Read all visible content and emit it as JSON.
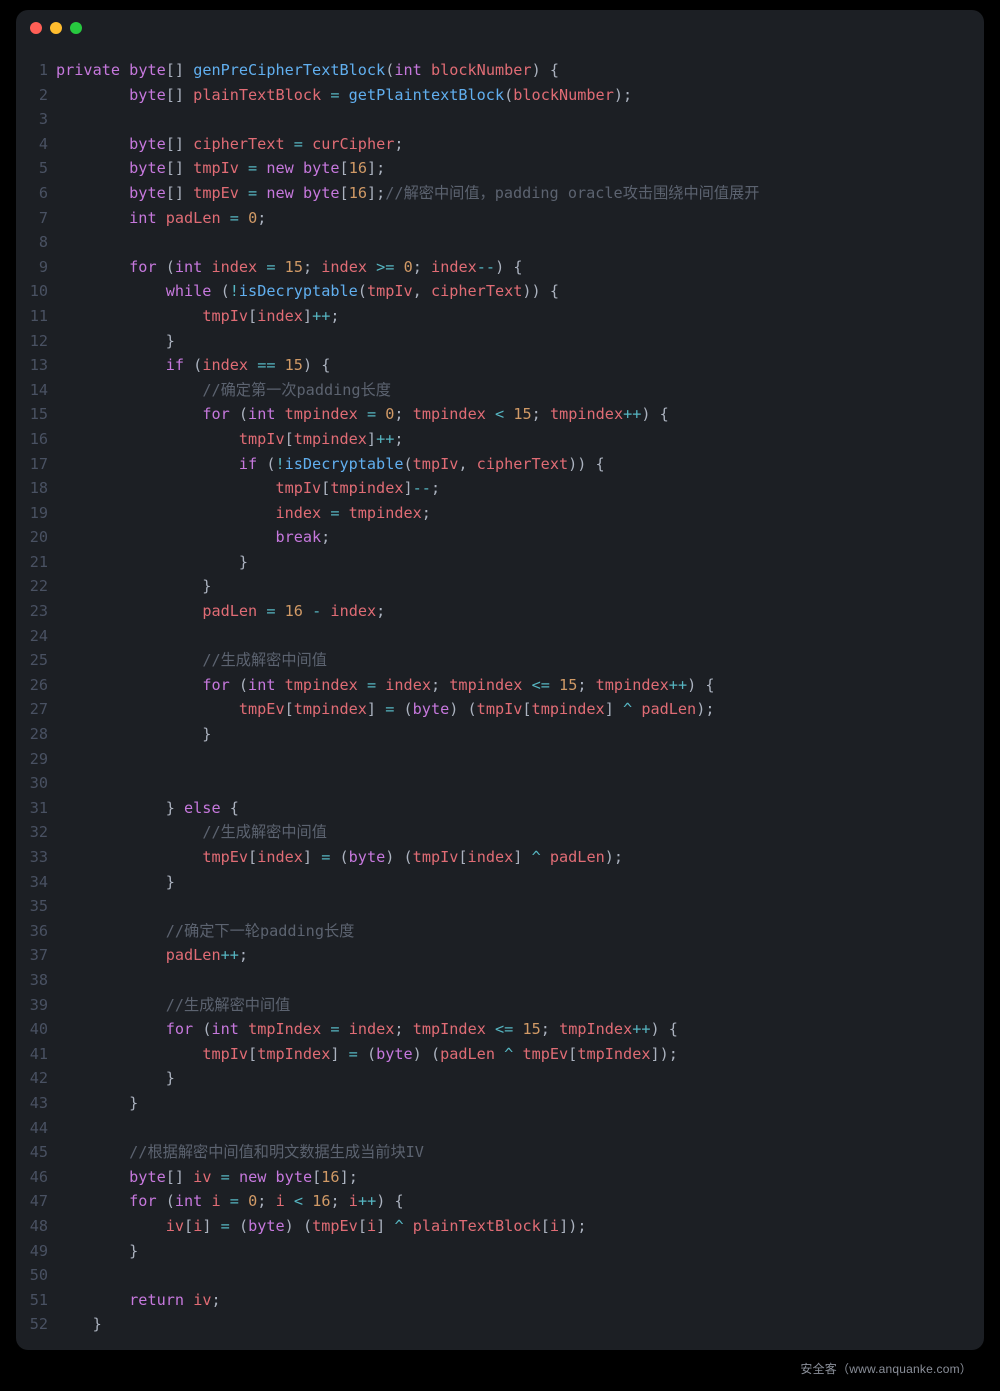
{
  "watermark": "安全客（www.anquanke.com）",
  "code": [
    [
      [
        "kw",
        "private"
      ],
      [
        "pun",
        " "
      ],
      [
        "type",
        "byte"
      ],
      [
        "pun",
        "[] "
      ],
      [
        "fn",
        "genPreCipherTextBlock"
      ],
      [
        "pun",
        "("
      ],
      [
        "type",
        "int"
      ],
      [
        "pun",
        " "
      ],
      [
        "id",
        "blockNumber"
      ],
      [
        "pun",
        ") {"
      ]
    ],
    [
      [
        "pun",
        "        "
      ],
      [
        "type",
        "byte"
      ],
      [
        "pun",
        "[] "
      ],
      [
        "id",
        "plainTextBlock"
      ],
      [
        "pun",
        " "
      ],
      [
        "op",
        "="
      ],
      [
        "pun",
        " "
      ],
      [
        "fn",
        "getPlaintextBlock"
      ],
      [
        "pun",
        "("
      ],
      [
        "id",
        "blockNumber"
      ],
      [
        "pun",
        ");"
      ]
    ],
    [],
    [
      [
        "pun",
        "        "
      ],
      [
        "type",
        "byte"
      ],
      [
        "pun",
        "[] "
      ],
      [
        "id",
        "cipherText"
      ],
      [
        "pun",
        " "
      ],
      [
        "op",
        "="
      ],
      [
        "pun",
        " "
      ],
      [
        "id",
        "curCipher"
      ],
      [
        "pun",
        ";"
      ]
    ],
    [
      [
        "pun",
        "        "
      ],
      [
        "type",
        "byte"
      ],
      [
        "pun",
        "[] "
      ],
      [
        "id",
        "tmpIv"
      ],
      [
        "pun",
        " "
      ],
      [
        "op",
        "="
      ],
      [
        "pun",
        " "
      ],
      [
        "kw",
        "new"
      ],
      [
        "pun",
        " "
      ],
      [
        "type",
        "byte"
      ],
      [
        "pun",
        "["
      ],
      [
        "num",
        "16"
      ],
      [
        "pun",
        "];"
      ]
    ],
    [
      [
        "pun",
        "        "
      ],
      [
        "type",
        "byte"
      ],
      [
        "pun",
        "[] "
      ],
      [
        "id",
        "tmpEv"
      ],
      [
        "pun",
        " "
      ],
      [
        "op",
        "="
      ],
      [
        "pun",
        " "
      ],
      [
        "kw",
        "new"
      ],
      [
        "pun",
        " "
      ],
      [
        "type",
        "byte"
      ],
      [
        "pun",
        "["
      ],
      [
        "num",
        "16"
      ],
      [
        "pun",
        "];"
      ],
      [
        "cmt",
        "//解密中间值，padding oracle攻击围绕中间值展开"
      ]
    ],
    [
      [
        "pun",
        "        "
      ],
      [
        "type",
        "int"
      ],
      [
        "pun",
        " "
      ],
      [
        "id",
        "padLen"
      ],
      [
        "pun",
        " "
      ],
      [
        "op",
        "="
      ],
      [
        "pun",
        " "
      ],
      [
        "num",
        "0"
      ],
      [
        "pun",
        ";"
      ]
    ],
    [],
    [
      [
        "pun",
        "        "
      ],
      [
        "kw",
        "for"
      ],
      [
        "pun",
        " ("
      ],
      [
        "type",
        "int"
      ],
      [
        "pun",
        " "
      ],
      [
        "id",
        "index"
      ],
      [
        "pun",
        " "
      ],
      [
        "op",
        "="
      ],
      [
        "pun",
        " "
      ],
      [
        "num",
        "15"
      ],
      [
        "pun",
        "; "
      ],
      [
        "id",
        "index"
      ],
      [
        "pun",
        " "
      ],
      [
        "op",
        ">="
      ],
      [
        "pun",
        " "
      ],
      [
        "num",
        "0"
      ],
      [
        "pun",
        "; "
      ],
      [
        "id",
        "index"
      ],
      [
        "op",
        "--"
      ],
      [
        "pun",
        ") {"
      ]
    ],
    [
      [
        "pun",
        "            "
      ],
      [
        "kw",
        "while"
      ],
      [
        "pun",
        " ("
      ],
      [
        "op",
        "!"
      ],
      [
        "fn",
        "isDecryptable"
      ],
      [
        "pun",
        "("
      ],
      [
        "id",
        "tmpIv"
      ],
      [
        "pun",
        ", "
      ],
      [
        "id",
        "cipherText"
      ],
      [
        "pun",
        ")) {"
      ]
    ],
    [
      [
        "pun",
        "                "
      ],
      [
        "id",
        "tmpIv"
      ],
      [
        "pun",
        "["
      ],
      [
        "id",
        "index"
      ],
      [
        "pun",
        "]"
      ],
      [
        "op",
        "++"
      ],
      [
        "pun",
        ";"
      ]
    ],
    [
      [
        "pun",
        "            }"
      ]
    ],
    [
      [
        "pun",
        "            "
      ],
      [
        "kw",
        "if"
      ],
      [
        "pun",
        " ("
      ],
      [
        "id",
        "index"
      ],
      [
        "pun",
        " "
      ],
      [
        "op",
        "=="
      ],
      [
        "pun",
        " "
      ],
      [
        "num",
        "15"
      ],
      [
        "pun",
        ") {"
      ]
    ],
    [
      [
        "pun",
        "                "
      ],
      [
        "cmt",
        "//确定第一次padding长度"
      ]
    ],
    [
      [
        "pun",
        "                "
      ],
      [
        "kw",
        "for"
      ],
      [
        "pun",
        " ("
      ],
      [
        "type",
        "int"
      ],
      [
        "pun",
        " "
      ],
      [
        "id",
        "tmpindex"
      ],
      [
        "pun",
        " "
      ],
      [
        "op",
        "="
      ],
      [
        "pun",
        " "
      ],
      [
        "num",
        "0"
      ],
      [
        "pun",
        "; "
      ],
      [
        "id",
        "tmpindex"
      ],
      [
        "pun",
        " "
      ],
      [
        "op",
        "<"
      ],
      [
        "pun",
        " "
      ],
      [
        "num",
        "15"
      ],
      [
        "pun",
        "; "
      ],
      [
        "id",
        "tmpindex"
      ],
      [
        "op",
        "++"
      ],
      [
        "pun",
        ") {"
      ]
    ],
    [
      [
        "pun",
        "                    "
      ],
      [
        "id",
        "tmpIv"
      ],
      [
        "pun",
        "["
      ],
      [
        "id",
        "tmpindex"
      ],
      [
        "pun",
        "]"
      ],
      [
        "op",
        "++"
      ],
      [
        "pun",
        ";"
      ]
    ],
    [
      [
        "pun",
        "                    "
      ],
      [
        "kw",
        "if"
      ],
      [
        "pun",
        " ("
      ],
      [
        "op",
        "!"
      ],
      [
        "fn",
        "isDecryptable"
      ],
      [
        "pun",
        "("
      ],
      [
        "id",
        "tmpIv"
      ],
      [
        "pun",
        ", "
      ],
      [
        "id",
        "cipherText"
      ],
      [
        "pun",
        ")) {"
      ]
    ],
    [
      [
        "pun",
        "                        "
      ],
      [
        "id",
        "tmpIv"
      ],
      [
        "pun",
        "["
      ],
      [
        "id",
        "tmpindex"
      ],
      [
        "pun",
        "]"
      ],
      [
        "op",
        "--"
      ],
      [
        "pun",
        ";"
      ]
    ],
    [
      [
        "pun",
        "                        "
      ],
      [
        "id",
        "index"
      ],
      [
        "pun",
        " "
      ],
      [
        "op",
        "="
      ],
      [
        "pun",
        " "
      ],
      [
        "id",
        "tmpindex"
      ],
      [
        "pun",
        ";"
      ]
    ],
    [
      [
        "pun",
        "                        "
      ],
      [
        "kw",
        "break"
      ],
      [
        "pun",
        ";"
      ]
    ],
    [
      [
        "pun",
        "                    }"
      ]
    ],
    [
      [
        "pun",
        "                }"
      ]
    ],
    [
      [
        "pun",
        "                "
      ],
      [
        "id",
        "padLen"
      ],
      [
        "pun",
        " "
      ],
      [
        "op",
        "="
      ],
      [
        "pun",
        " "
      ],
      [
        "num",
        "16"
      ],
      [
        "pun",
        " "
      ],
      [
        "op",
        "-"
      ],
      [
        "pun",
        " "
      ],
      [
        "id",
        "index"
      ],
      [
        "pun",
        ";"
      ]
    ],
    [],
    [
      [
        "pun",
        "                "
      ],
      [
        "cmt",
        "//生成解密中间值"
      ]
    ],
    [
      [
        "pun",
        "                "
      ],
      [
        "kw",
        "for"
      ],
      [
        "pun",
        " ("
      ],
      [
        "type",
        "int"
      ],
      [
        "pun",
        " "
      ],
      [
        "id",
        "tmpindex"
      ],
      [
        "pun",
        " "
      ],
      [
        "op",
        "="
      ],
      [
        "pun",
        " "
      ],
      [
        "id",
        "index"
      ],
      [
        "pun",
        "; "
      ],
      [
        "id",
        "tmpindex"
      ],
      [
        "pun",
        " "
      ],
      [
        "op",
        "<="
      ],
      [
        "pun",
        " "
      ],
      [
        "num",
        "15"
      ],
      [
        "pun",
        "; "
      ],
      [
        "id",
        "tmpindex"
      ],
      [
        "op",
        "++"
      ],
      [
        "pun",
        ") {"
      ]
    ],
    [
      [
        "pun",
        "                    "
      ],
      [
        "id",
        "tmpEv"
      ],
      [
        "pun",
        "["
      ],
      [
        "id",
        "tmpindex"
      ],
      [
        "pun",
        "] "
      ],
      [
        "op",
        "="
      ],
      [
        "pun",
        " ("
      ],
      [
        "type",
        "byte"
      ],
      [
        "pun",
        ") ("
      ],
      [
        "id",
        "tmpIv"
      ],
      [
        "pun",
        "["
      ],
      [
        "id",
        "tmpindex"
      ],
      [
        "pun",
        "] "
      ],
      [
        "op",
        "^"
      ],
      [
        "pun",
        " "
      ],
      [
        "id",
        "padLen"
      ],
      [
        "pun",
        ");"
      ]
    ],
    [
      [
        "pun",
        "                }"
      ]
    ],
    [],
    [],
    [
      [
        "pun",
        "            } "
      ],
      [
        "kw",
        "else"
      ],
      [
        "pun",
        " {"
      ]
    ],
    [
      [
        "pun",
        "                "
      ],
      [
        "cmt",
        "//生成解密中间值"
      ]
    ],
    [
      [
        "pun",
        "                "
      ],
      [
        "id",
        "tmpEv"
      ],
      [
        "pun",
        "["
      ],
      [
        "id",
        "index"
      ],
      [
        "pun",
        "] "
      ],
      [
        "op",
        "="
      ],
      [
        "pun",
        " ("
      ],
      [
        "type",
        "byte"
      ],
      [
        "pun",
        ") ("
      ],
      [
        "id",
        "tmpIv"
      ],
      [
        "pun",
        "["
      ],
      [
        "id",
        "index"
      ],
      [
        "pun",
        "] "
      ],
      [
        "op",
        "^"
      ],
      [
        "pun",
        " "
      ],
      [
        "id",
        "padLen"
      ],
      [
        "pun",
        ");"
      ]
    ],
    [
      [
        "pun",
        "            }"
      ]
    ],
    [],
    [
      [
        "pun",
        "            "
      ],
      [
        "cmt",
        "//确定下一轮padding长度"
      ]
    ],
    [
      [
        "pun",
        "            "
      ],
      [
        "id",
        "padLen"
      ],
      [
        "op",
        "++"
      ],
      [
        "pun",
        ";"
      ]
    ],
    [],
    [
      [
        "pun",
        "            "
      ],
      [
        "cmt",
        "//生成解密中间值"
      ]
    ],
    [
      [
        "pun",
        "            "
      ],
      [
        "kw",
        "for"
      ],
      [
        "pun",
        " ("
      ],
      [
        "type",
        "int"
      ],
      [
        "pun",
        " "
      ],
      [
        "id",
        "tmpIndex"
      ],
      [
        "pun",
        " "
      ],
      [
        "op",
        "="
      ],
      [
        "pun",
        " "
      ],
      [
        "id",
        "index"
      ],
      [
        "pun",
        "; "
      ],
      [
        "id",
        "tmpIndex"
      ],
      [
        "pun",
        " "
      ],
      [
        "op",
        "<="
      ],
      [
        "pun",
        " "
      ],
      [
        "num",
        "15"
      ],
      [
        "pun",
        "; "
      ],
      [
        "id",
        "tmpIndex"
      ],
      [
        "op",
        "++"
      ],
      [
        "pun",
        ") {"
      ]
    ],
    [
      [
        "pun",
        "                "
      ],
      [
        "id",
        "tmpIv"
      ],
      [
        "pun",
        "["
      ],
      [
        "id",
        "tmpIndex"
      ],
      [
        "pun",
        "] "
      ],
      [
        "op",
        "="
      ],
      [
        "pun",
        " ("
      ],
      [
        "type",
        "byte"
      ],
      [
        "pun",
        ") ("
      ],
      [
        "id",
        "padLen"
      ],
      [
        "pun",
        " "
      ],
      [
        "op",
        "^"
      ],
      [
        "pun",
        " "
      ],
      [
        "id",
        "tmpEv"
      ],
      [
        "pun",
        "["
      ],
      [
        "id",
        "tmpIndex"
      ],
      [
        "pun",
        "]);"
      ]
    ],
    [
      [
        "pun",
        "            }"
      ]
    ],
    [
      [
        "pun",
        "        }"
      ]
    ],
    [],
    [
      [
        "pun",
        "        "
      ],
      [
        "cmt",
        "//根据解密中间值和明文数据生成当前块IV"
      ]
    ],
    [
      [
        "pun",
        "        "
      ],
      [
        "type",
        "byte"
      ],
      [
        "pun",
        "[] "
      ],
      [
        "id",
        "iv"
      ],
      [
        "pun",
        " "
      ],
      [
        "op",
        "="
      ],
      [
        "pun",
        " "
      ],
      [
        "kw",
        "new"
      ],
      [
        "pun",
        " "
      ],
      [
        "type",
        "byte"
      ],
      [
        "pun",
        "["
      ],
      [
        "num",
        "16"
      ],
      [
        "pun",
        "];"
      ]
    ],
    [
      [
        "pun",
        "        "
      ],
      [
        "kw",
        "for"
      ],
      [
        "pun",
        " ("
      ],
      [
        "type",
        "int"
      ],
      [
        "pun",
        " "
      ],
      [
        "id",
        "i"
      ],
      [
        "pun",
        " "
      ],
      [
        "op",
        "="
      ],
      [
        "pun",
        " "
      ],
      [
        "num",
        "0"
      ],
      [
        "pun",
        "; "
      ],
      [
        "id",
        "i"
      ],
      [
        "pun",
        " "
      ],
      [
        "op",
        "<"
      ],
      [
        "pun",
        " "
      ],
      [
        "num",
        "16"
      ],
      [
        "pun",
        "; "
      ],
      [
        "id",
        "i"
      ],
      [
        "op",
        "++"
      ],
      [
        "pun",
        ") {"
      ]
    ],
    [
      [
        "pun",
        "            "
      ],
      [
        "id",
        "iv"
      ],
      [
        "pun",
        "["
      ],
      [
        "id",
        "i"
      ],
      [
        "pun",
        "] "
      ],
      [
        "op",
        "="
      ],
      [
        "pun",
        " ("
      ],
      [
        "type",
        "byte"
      ],
      [
        "pun",
        ") ("
      ],
      [
        "id",
        "tmpEv"
      ],
      [
        "pun",
        "["
      ],
      [
        "id",
        "i"
      ],
      [
        "pun",
        "] "
      ],
      [
        "op",
        "^"
      ],
      [
        "pun",
        " "
      ],
      [
        "id",
        "plainTextBlock"
      ],
      [
        "pun",
        "["
      ],
      [
        "id",
        "i"
      ],
      [
        "pun",
        "]);"
      ]
    ],
    [
      [
        "pun",
        "        }"
      ]
    ],
    [],
    [
      [
        "pun",
        "        "
      ],
      [
        "kw",
        "return"
      ],
      [
        "pun",
        " "
      ],
      [
        "id",
        "iv"
      ],
      [
        "pun",
        ";"
      ]
    ],
    [
      [
        "pun",
        "    }"
      ]
    ]
  ]
}
